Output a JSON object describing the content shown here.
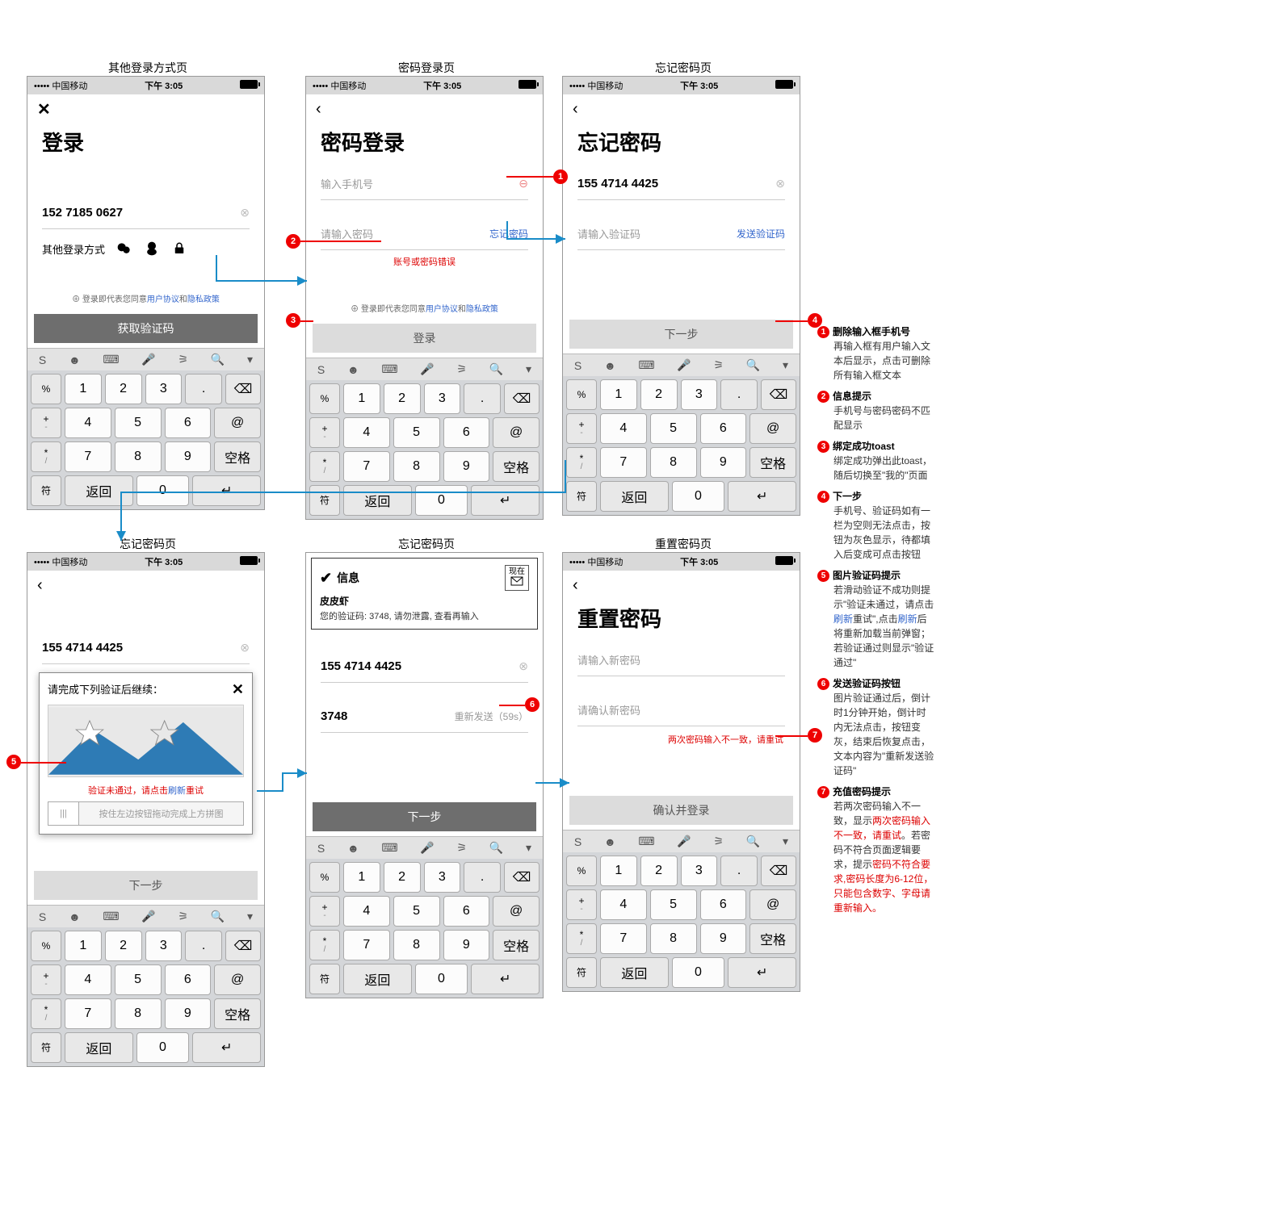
{
  "status": {
    "carrier": "中国移动",
    "signal": "•••••",
    "time": "下午 3:05"
  },
  "screens": {
    "otherLogin": {
      "label": "其他登录方式页",
      "title": "登录",
      "phone": "152 7185 0627",
      "otherLoginText": "其他登录方式",
      "agreementPrefix": "登录即代表您同意",
      "userAgreement": "用户协议",
      "and": "和",
      "privacy": "隐私政策",
      "button": "获取验证码"
    },
    "pwdLogin": {
      "label": "密码登录页",
      "title": "密码登录",
      "phonePlaceholder": "输入手机号",
      "pwdPlaceholder": "请输入密码",
      "forgotPwd": "忘记密码",
      "error": "账号或密码错误",
      "button": "登录"
    },
    "forgot1": {
      "label": "忘记密码页",
      "title": "忘记密码",
      "phone": "155 4714 4425",
      "codePlaceholder": "请输入验证码",
      "sendCode": "发送验证码",
      "button": "下一步"
    },
    "forgot2": {
      "label": "忘记密码页",
      "phone": "155 4714 4425",
      "captchaTitle": "请完成下列验证后继续：",
      "captchaStatus": "验证未通过，请点击",
      "captchaRefresh": "刷新",
      "captchaRetry": "重试",
      "sliderText": "按住左边按钮拖动完成上方拼图",
      "button": "下一步"
    },
    "forgot3": {
      "label": "忘记密码页",
      "infoTitle": "信息",
      "infoSender": "皮皮虾",
      "infoTime": "现在",
      "infoBody": "您的验证码: 3748, 请勿泄露, 查看再输入",
      "phone": "155 4714 4425",
      "code": "3748",
      "resend": "重新发送（59s）",
      "button": "下一步"
    },
    "reset": {
      "label": "重置密码页",
      "title": "重置密码",
      "newPwdPlaceholder": "请输入新密码",
      "confirmPlaceholder": "请确认新密码",
      "error": "两次密码输入不一致，请重试",
      "button": "确认并登录"
    }
  },
  "keyboard": {
    "toolbar": [
      "S",
      "☻",
      "⌨",
      "🎤",
      "⚞",
      "🔍",
      "▾"
    ],
    "sideCol": [
      {
        "main": "%",
        "sub": ""
      },
      {
        "main": "+",
        "sub": "-"
      },
      {
        "main": "*",
        "sub": "/"
      },
      {
        "main": "符",
        "sub": ""
      }
    ],
    "rows": [
      [
        "1",
        "2",
        "3",
        "."
      ],
      [
        "4",
        "5",
        "6",
        "@"
      ],
      [
        "7",
        "8",
        "9",
        "空格"
      ],
      [
        "返回",
        "0",
        "↵"
      ]
    ],
    "backspace": "⌫"
  },
  "notes": [
    {
      "n": "1",
      "title": "删除输入框手机号",
      "body": "再输入框有用户输入文本后显示，点击可删除所有输入框文本"
    },
    {
      "n": "2",
      "title": "信息提示",
      "body": "手机号与密码密码不匹配显示"
    },
    {
      "n": "3",
      "title": "绑定成功toast",
      "body": "绑定成功弹出此toast，随后切换至\"我的\"页面"
    },
    {
      "n": "4",
      "title": "下一步",
      "body": "手机号、验证码如有一栏为空则无法点击，按钮为灰色显示，待都填入后变成可点击按钮"
    },
    {
      "n": "5",
      "title": "图片验证码提示",
      "body": "若滑动验证不成功则提示\"验证未通过，请点击<span class='blue'>刷新</span>重试\",点击<span class='blue'>刷新</span>后将重新加载当前弹窗；若验证通过则显示\"验证通过\""
    },
    {
      "n": "6",
      "title": "发送验证码按钮",
      "body": "图片验证通过后，倒计时1分钟开始，倒计时内无法点击，按钮变灰，结束后恢复点击，文本内容为\"重新发送验证码\""
    },
    {
      "n": "7",
      "title": "充值密码提示",
      "body": "若两次密码输入不一致，显示<span class='red'>两次密码输入不一致，请重试</span>。若密码不符合页面逻辑要求，提示<span class='red'>密码不符合要求,密码长度为6-12位，只能包含数字、字母请重新输入。</span>"
    }
  ]
}
